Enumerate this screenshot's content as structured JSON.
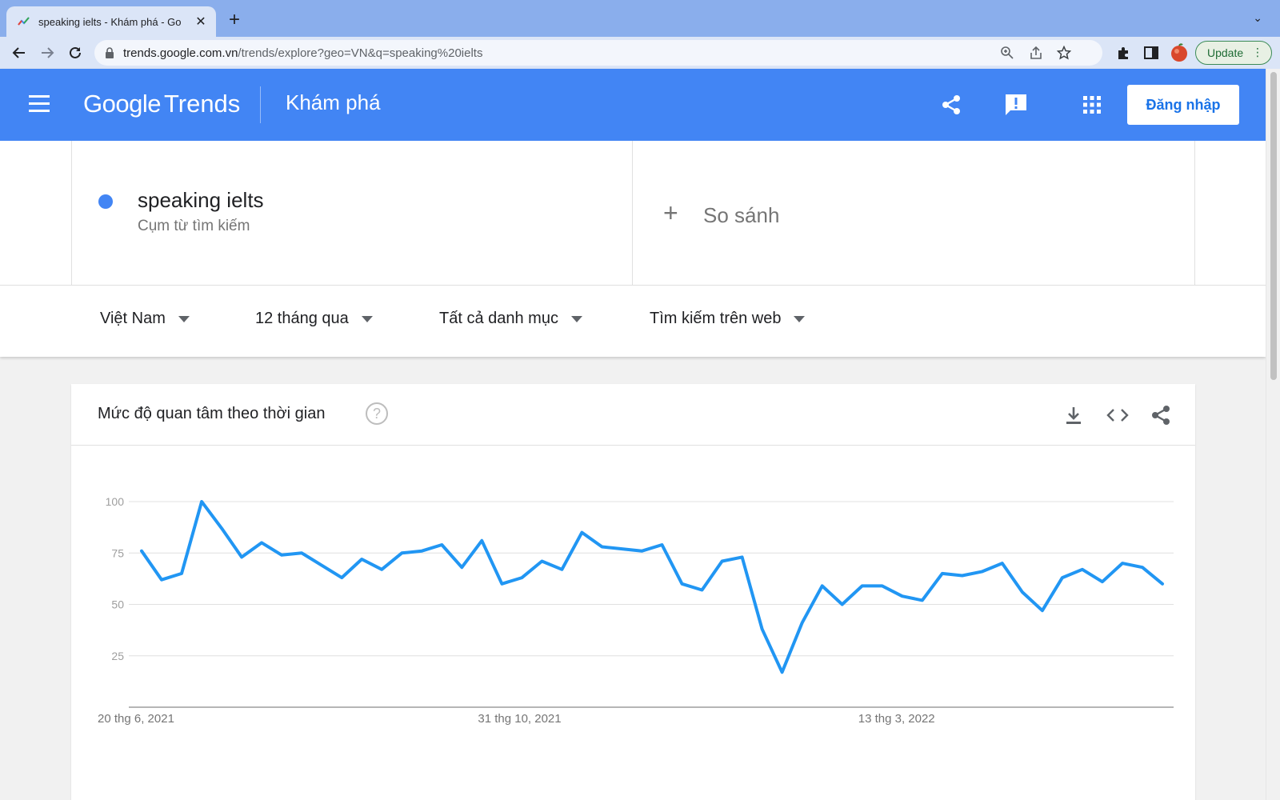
{
  "browser": {
    "tab_title": "speaking ielts - Khám phá - Go",
    "url_host": "trends.google.com.vn",
    "url_path": "/trends/explore?geo=VN&q=speaking%20ielts",
    "update_label": "Update"
  },
  "header": {
    "logo_google": "Google",
    "logo_trends": "Trends",
    "title": "Khám phá",
    "signin_label": "Đăng nhập"
  },
  "term": {
    "name": "speaking ielts",
    "type": "Cụm từ tìm kiếm",
    "color": "#4285f4"
  },
  "compare": {
    "label": "So sánh"
  },
  "filters": {
    "region": "Việt Nam",
    "time": "12 tháng qua",
    "category": "Tất cả danh mục",
    "search_type": "Tìm kiếm trên web"
  },
  "card": {
    "title": "Mức độ quan tâm theo thời gian",
    "help": "?"
  },
  "chart_data": {
    "type": "line",
    "title": "Mức độ quan tâm theo thời gian",
    "ylim": [
      0,
      100
    ],
    "yticks": [
      25,
      50,
      75,
      100
    ],
    "grid": true,
    "line_color": "#2196f3",
    "x_labels": [
      "20 thg 6, 2021",
      "31 thg 10, 2021",
      "13 thg 3, 2022"
    ],
    "x_label_positions": [
      0,
      19,
      38
    ],
    "series": [
      {
        "values": [
          76,
          62,
          65,
          100,
          87,
          73,
          80,
          74,
          75,
          69,
          63,
          72,
          67,
          75,
          76,
          79,
          68,
          81,
          60,
          63,
          71,
          67,
          85,
          78,
          77,
          76,
          79,
          60,
          57,
          71,
          73,
          38,
          17,
          41,
          59,
          50,
          59,
          59,
          54,
          52,
          65,
          64,
          66,
          70,
          56,
          47,
          63,
          67,
          61,
          70,
          68,
          60
        ]
      }
    ]
  }
}
